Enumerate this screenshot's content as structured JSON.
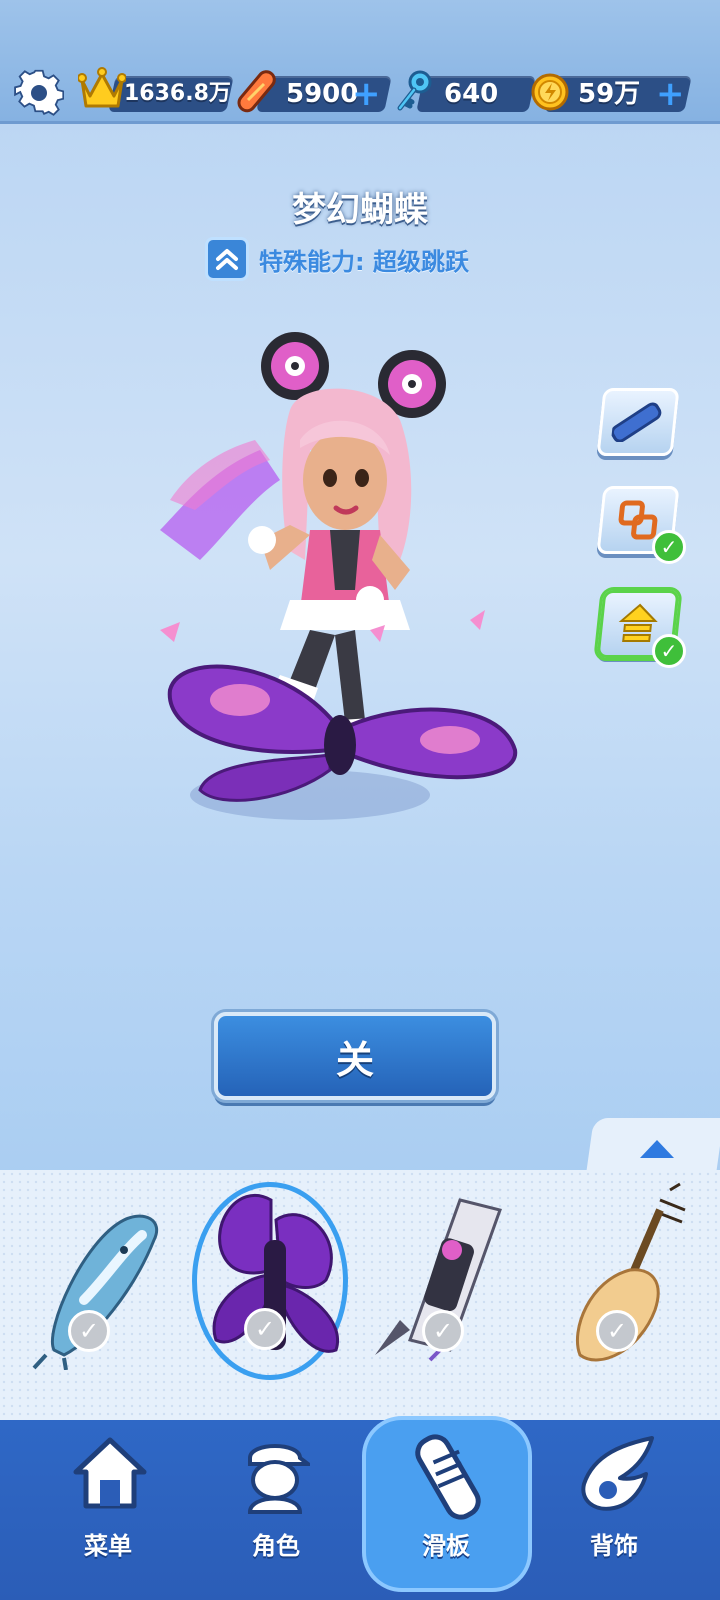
{
  "resources": {
    "crowns": "1636.8万",
    "hoverboards": "5900",
    "keys": "640",
    "coins": "59万",
    "plus_symbol": "+"
  },
  "board": {
    "name": "梦幻蝴蝶",
    "ability": "特殊能力: 超级跳跃"
  },
  "main_button_label": "关",
  "side_buttons": [
    {
      "icon": "board-icon",
      "checked": false
    },
    {
      "icon": "link-icon",
      "checked": true
    },
    {
      "icon": "upgrade-arrow-icon",
      "checked": true
    }
  ],
  "carousel": {
    "items": [
      {
        "name": "whale-board",
        "owned": true
      },
      {
        "name": "butterfly-board",
        "owned": true,
        "selected": true
      },
      {
        "name": "rocket-board",
        "owned": true
      },
      {
        "name": "pipa-board",
        "owned": true
      }
    ],
    "check_symbol": "✓"
  },
  "nav": {
    "items": [
      {
        "label": "菜单",
        "icon": "house-icon"
      },
      {
        "label": "角色",
        "icon": "character-icon"
      },
      {
        "label": "滑板",
        "icon": "hoverboard-icon",
        "active": true
      },
      {
        "label": "背饰",
        "icon": "wing-icon"
      }
    ]
  },
  "colors": {
    "accent_blue": "#2f7ae0",
    "check_green": "#3fbf3a",
    "nav_blue": "#2b5db7"
  }
}
